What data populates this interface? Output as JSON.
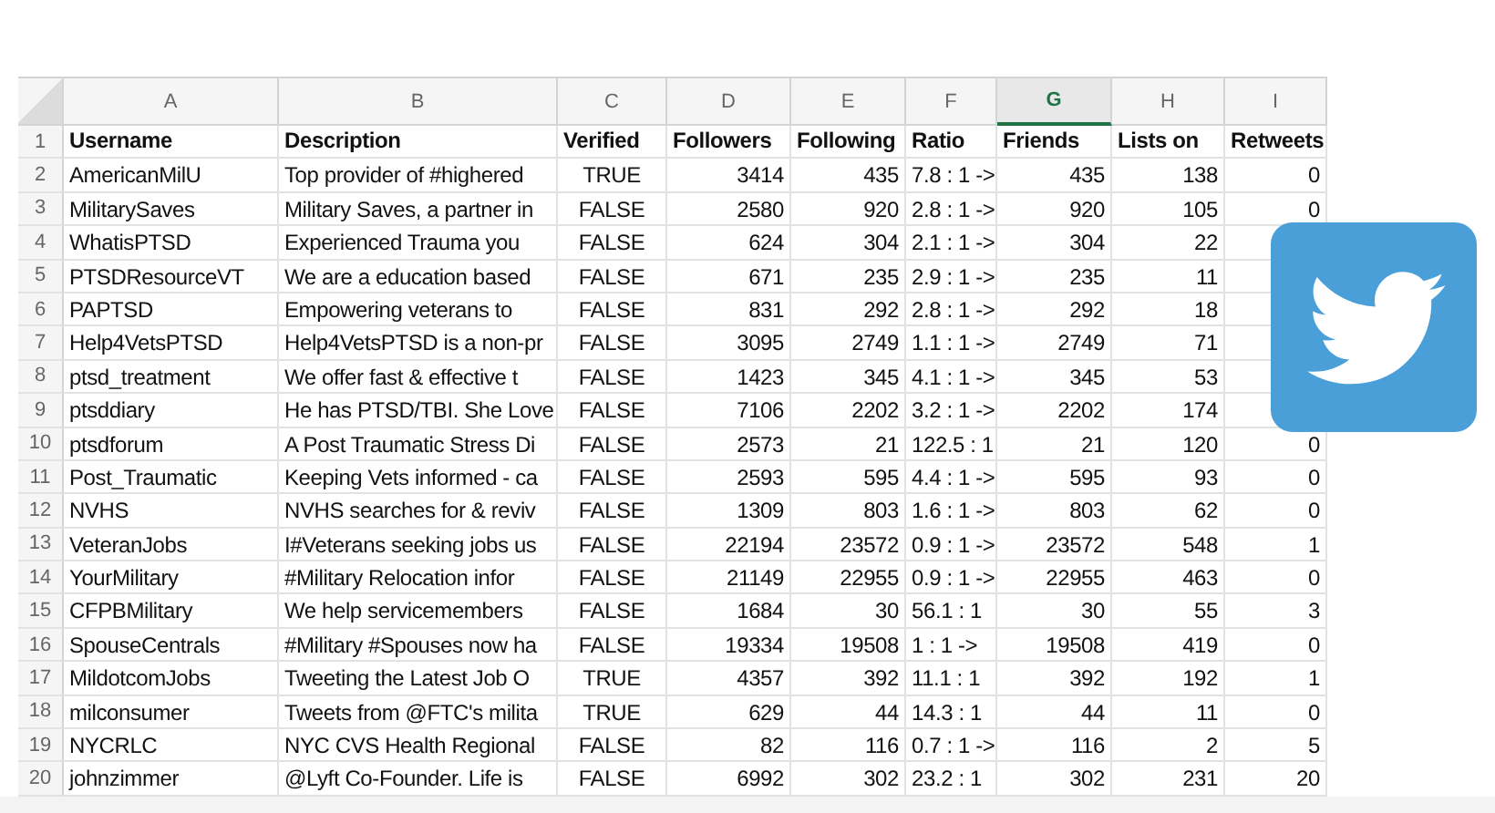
{
  "sheet": {
    "columns": [
      {
        "letter": "A",
        "kind": "text",
        "selected": false
      },
      {
        "letter": "B",
        "kind": "text",
        "selected": false
      },
      {
        "letter": "C",
        "kind": "bool",
        "selected": false
      },
      {
        "letter": "D",
        "kind": "number",
        "selected": false
      },
      {
        "letter": "E",
        "kind": "number",
        "selected": false
      },
      {
        "letter": "F",
        "kind": "text",
        "selected": false
      },
      {
        "letter": "G",
        "kind": "number",
        "selected": true
      },
      {
        "letter": "H",
        "kind": "number",
        "selected": false
      },
      {
        "letter": "I",
        "kind": "number",
        "selected": false
      }
    ],
    "header_row": {
      "number": "1",
      "cells": [
        "Username",
        "Description",
        "Verified",
        "Followers",
        "Following",
        "Ratio",
        "Friends",
        "Lists on",
        "Retweets"
      ]
    },
    "rows": [
      {
        "number": "2",
        "cells": [
          "AmericanMilU",
          "Top provider of #highered",
          "TRUE",
          "3414",
          "435",
          "7.8 : 1 ->",
          "435",
          "138",
          "0"
        ]
      },
      {
        "number": "3",
        "cells": [
          "MilitarySaves",
          "Military Saves, a partner in",
          "FALSE",
          "2580",
          "920",
          "2.8 : 1 ->",
          "920",
          "105",
          "0"
        ]
      },
      {
        "number": "4",
        "cells": [
          "WhatisPTSD",
          "Experienced Trauma you",
          "FALSE",
          "624",
          "304",
          "2.1 : 1 ->",
          "304",
          "22"
        ]
      },
      {
        "number": "5",
        "cells": [
          "PTSDResourceVT",
          "We are a education based",
          "FALSE",
          "671",
          "235",
          "2.9 : 1 ->",
          "235",
          "11"
        ]
      },
      {
        "number": "6",
        "cells": [
          "PAPTSD",
          "Empowering veterans to",
          "FALSE",
          "831",
          "292",
          "2.8 : 1 ->",
          "292",
          "18"
        ]
      },
      {
        "number": "7",
        "cells": [
          "Help4VetsPTSD",
          "Help4VetsPTSD is a non-pr",
          "FALSE",
          "3095",
          "2749",
          "1.1 : 1 ->",
          "2749",
          "71"
        ]
      },
      {
        "number": "8",
        "cells": [
          "ptsd_treatment",
          "We offer fast & effective t",
          "FALSE",
          "1423",
          "345",
          "4.1 : 1 ->",
          "345",
          "53"
        ]
      },
      {
        "number": "9",
        "cells": [
          "ptsddiary",
          "He has PTSD/TBI. She Love",
          "FALSE",
          "7106",
          "2202",
          "3.2 : 1 ->",
          "2202",
          "174"
        ]
      },
      {
        "number": "10",
        "cells": [
          "ptsdforum",
          "A Post Traumatic Stress Di",
          "FALSE",
          "2573",
          "21",
          "122.5 : 1",
          "21",
          "120",
          "0"
        ]
      },
      {
        "number": "11",
        "cells": [
          "Post_Traumatic",
          "Keeping Vets informed - ca",
          "FALSE",
          "2593",
          "595",
          "4.4 : 1 ->",
          "595",
          "93",
          "0"
        ]
      },
      {
        "number": "12",
        "cells": [
          "NVHS",
          "NVHS searches for & reviv",
          "FALSE",
          "1309",
          "803",
          "1.6 : 1 ->",
          "803",
          "62",
          "0"
        ]
      },
      {
        "number": "13",
        "cells": [
          "VeteranJobs",
          "I#Veterans seeking jobs us",
          "FALSE",
          "22194",
          "23572",
          "0.9 : 1 ->",
          "23572",
          "548",
          "1"
        ]
      },
      {
        "number": "14",
        "cells": [
          "YourMilitary",
          "#Military Relocation infor",
          "FALSE",
          "21149",
          "22955",
          "0.9 : 1 ->",
          "22955",
          "463",
          "0"
        ]
      },
      {
        "number": "15",
        "cells": [
          "CFPBMilitary",
          "We help servicemembers",
          "FALSE",
          "1684",
          "30",
          "56.1 : 1",
          "30",
          "55",
          "3"
        ]
      },
      {
        "number": "16",
        "cells": [
          "SpouseCentrals",
          "#Military #Spouses now ha",
          "FALSE",
          "19334",
          "19508",
          "1 : 1 ->",
          "19508",
          "419",
          "0"
        ]
      },
      {
        "number": "17",
        "cells": [
          "MildotcomJobs",
          "Tweeting the Latest Job O",
          "TRUE",
          "4357",
          "392",
          "11.1 : 1",
          "392",
          "192",
          "1"
        ]
      },
      {
        "number": "18",
        "cells": [
          "milconsumer",
          "Tweets from @FTC's milita",
          "TRUE",
          "629",
          "44",
          "14.3 : 1",
          "44",
          "11",
          "0"
        ]
      },
      {
        "number": "19",
        "cells": [
          "NYCRLC",
          "NYC CVS Health Regional",
          "FALSE",
          "82",
          "116",
          "0.7 : 1 ->",
          "116",
          "2",
          "5"
        ]
      },
      {
        "number": "20",
        "cells": [
          "johnzimmer",
          "@Lyft Co-Founder. Life is",
          "FALSE",
          "6992",
          "302",
          "23.2 : 1",
          "302",
          "231",
          "20"
        ]
      }
    ]
  }
}
